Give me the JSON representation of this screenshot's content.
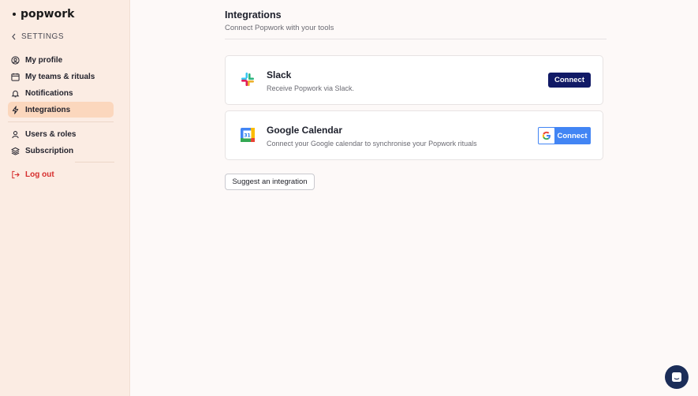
{
  "sidebar": {
    "brand": "popwork",
    "back_label": "SETTINGS",
    "items": [
      {
        "label": "My profile"
      },
      {
        "label": "My teams & rituals"
      },
      {
        "label": "Notifications"
      },
      {
        "label": "Integrations"
      },
      {
        "label": "Users & roles"
      },
      {
        "label": "Subscription"
      }
    ],
    "logout_label": "Log out"
  },
  "page": {
    "title": "Integrations",
    "subtitle": "Connect Popwork with your tools"
  },
  "integrations": [
    {
      "name": "Slack",
      "description": "Receive Popwork via Slack.",
      "button": "Connect",
      "icon": "slack-logo"
    },
    {
      "name": "Google Calendar",
      "description": "Connect your Google calendar to synchronise your Popwork rituals",
      "button": "Connect",
      "icon": "google-calendar-logo",
      "calendar_day": "31"
    }
  ],
  "suggest_button": "Suggest an integration",
  "colors": {
    "sidebar_bg": "#fbece3",
    "active_item_bg": "#fbd7bd",
    "primary_button": "#111a66",
    "google_button": "#4285f4",
    "logout": "#d62c2c"
  }
}
